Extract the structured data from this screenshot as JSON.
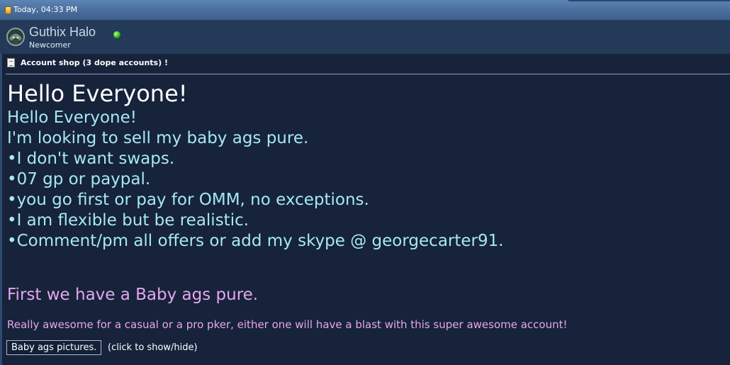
{
  "post": {
    "date": "Today, 04:33 PM"
  },
  "user": {
    "name": "Guthix Halo",
    "title": "Newcomer",
    "status_color": "#3fbf1a"
  },
  "thread": {
    "title": "Account shop (3 dope accounts) !"
  },
  "body": {
    "heading": "Hello Everyone!",
    "lines": [
      "Hello Everyone!",
      "I'm looking to sell my baby ags pure.",
      "•I don't want swaps.",
      "•07 gp or paypal.",
      "•you go first or pay for OMM, no exceptions.",
      "•I am flexible but be realistic.",
      "•Comment/pm all offers or add my skype @ georgecarter91."
    ],
    "section_heading": "First we have a Baby ags pure.",
    "description": "Really awesome for a casual or a pro pker, either one will have a blast with this super awesome account!",
    "spoiler_button": "Baby ags pictures.",
    "spoiler_hint": "(click to show/hide)"
  },
  "colors": {
    "background": "#16233a",
    "body_text": "#a6e8f1",
    "accent_text": "#e6a6ee"
  },
  "icons": {
    "date": "post-date-icon",
    "avatar": "guthix-helmet-icon",
    "status": "online-status-icon",
    "thread": "document-icon"
  }
}
